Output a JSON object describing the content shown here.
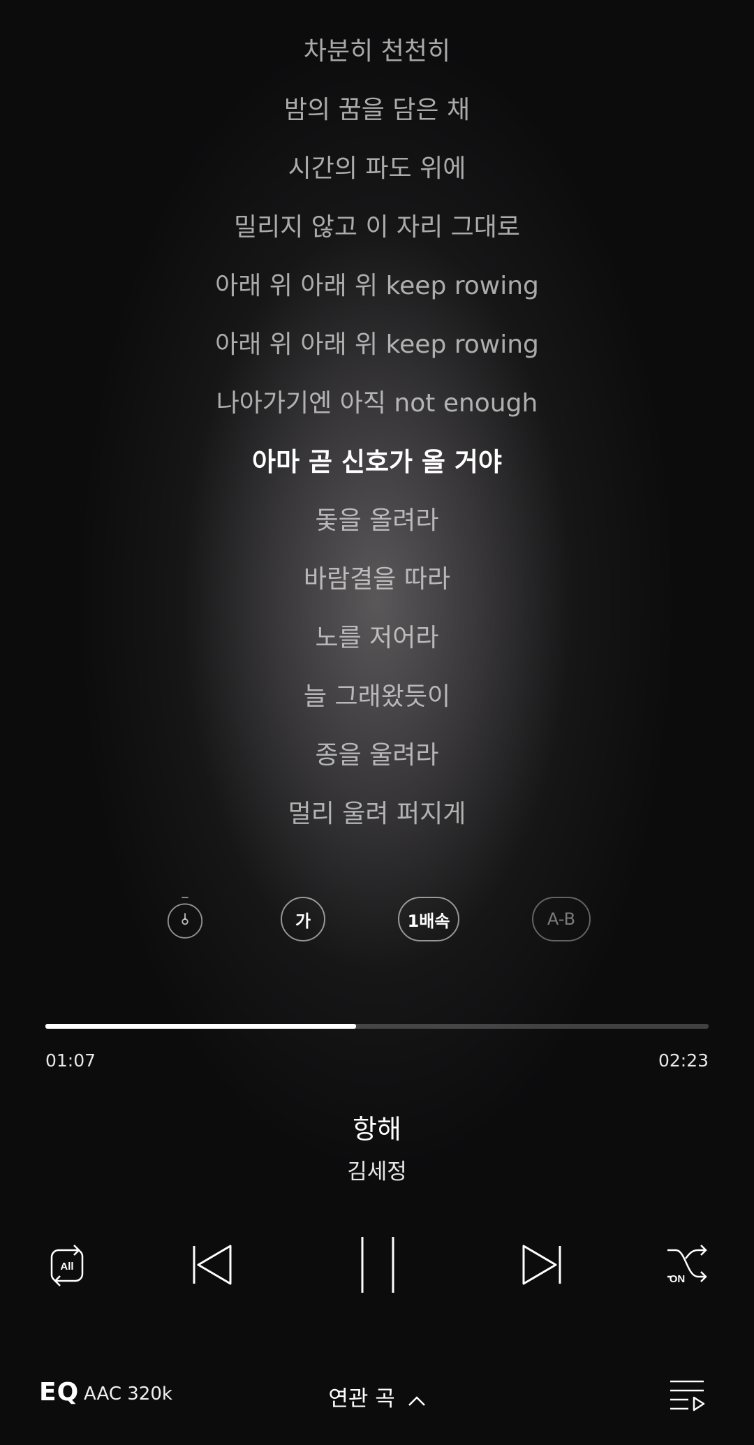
{
  "lyrics": [
    "차분히 천천히",
    "밤의 꿈을 담은 채",
    "시간의 파도 위에",
    "밀리지 않고 이 자리 그대로",
    "아래 위 아래 위 keep rowing",
    "아래 위 아래 위 keep rowing",
    "나아가기엔 아직 not enough",
    "아마 곧 신호가 올 거야",
    "돛을 올려라",
    "바람결을 따라",
    "노를 저어라",
    "늘 그래왔듯이",
    "종을 울려라",
    "멀리 울려 퍼지게"
  ],
  "current_lyric_index": 7,
  "lyric_controls": {
    "timer_icon": "timer-icon",
    "font_size_label": "가",
    "speed_label": "1배속",
    "ab_repeat_label": "A-B"
  },
  "progress": {
    "elapsed": "01:07",
    "total": "02:23",
    "fraction": 0.468
  },
  "track": {
    "title": "항해",
    "artist": "김세정"
  },
  "playback": {
    "repeat_label": "All",
    "shuffle_label": "ON",
    "state": "playing"
  },
  "bottom": {
    "eq_label": "EQ",
    "quality": "AAC 320k",
    "related_label": "연관 곡"
  },
  "colors": {
    "background": "#0c0c0d",
    "accent": "#ffffff"
  }
}
